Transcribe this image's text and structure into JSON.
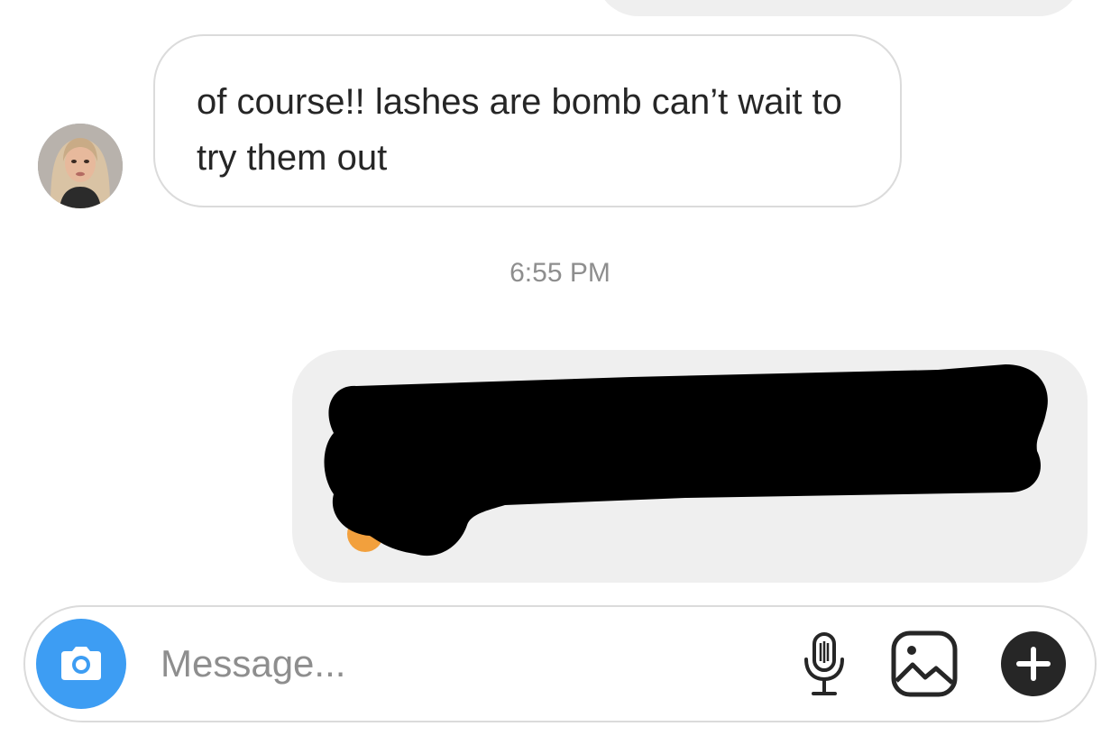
{
  "thread": {
    "incoming_message": "of course!! lashes are bomb can’t wait to try them out",
    "timestamp": "6:55 PM"
  },
  "composer": {
    "placeholder": "Message...",
    "icons": {
      "camera": "camera-icon",
      "microphone": "microphone-icon",
      "gallery": "image-icon",
      "add": "plus-icon"
    }
  },
  "colors": {
    "camera_button": "#3d9df3",
    "outgoing_bubble": "#efefef",
    "incoming_border": "#dbdbdb",
    "timestamp_text": "#8e8e8e",
    "text": "#262626"
  }
}
